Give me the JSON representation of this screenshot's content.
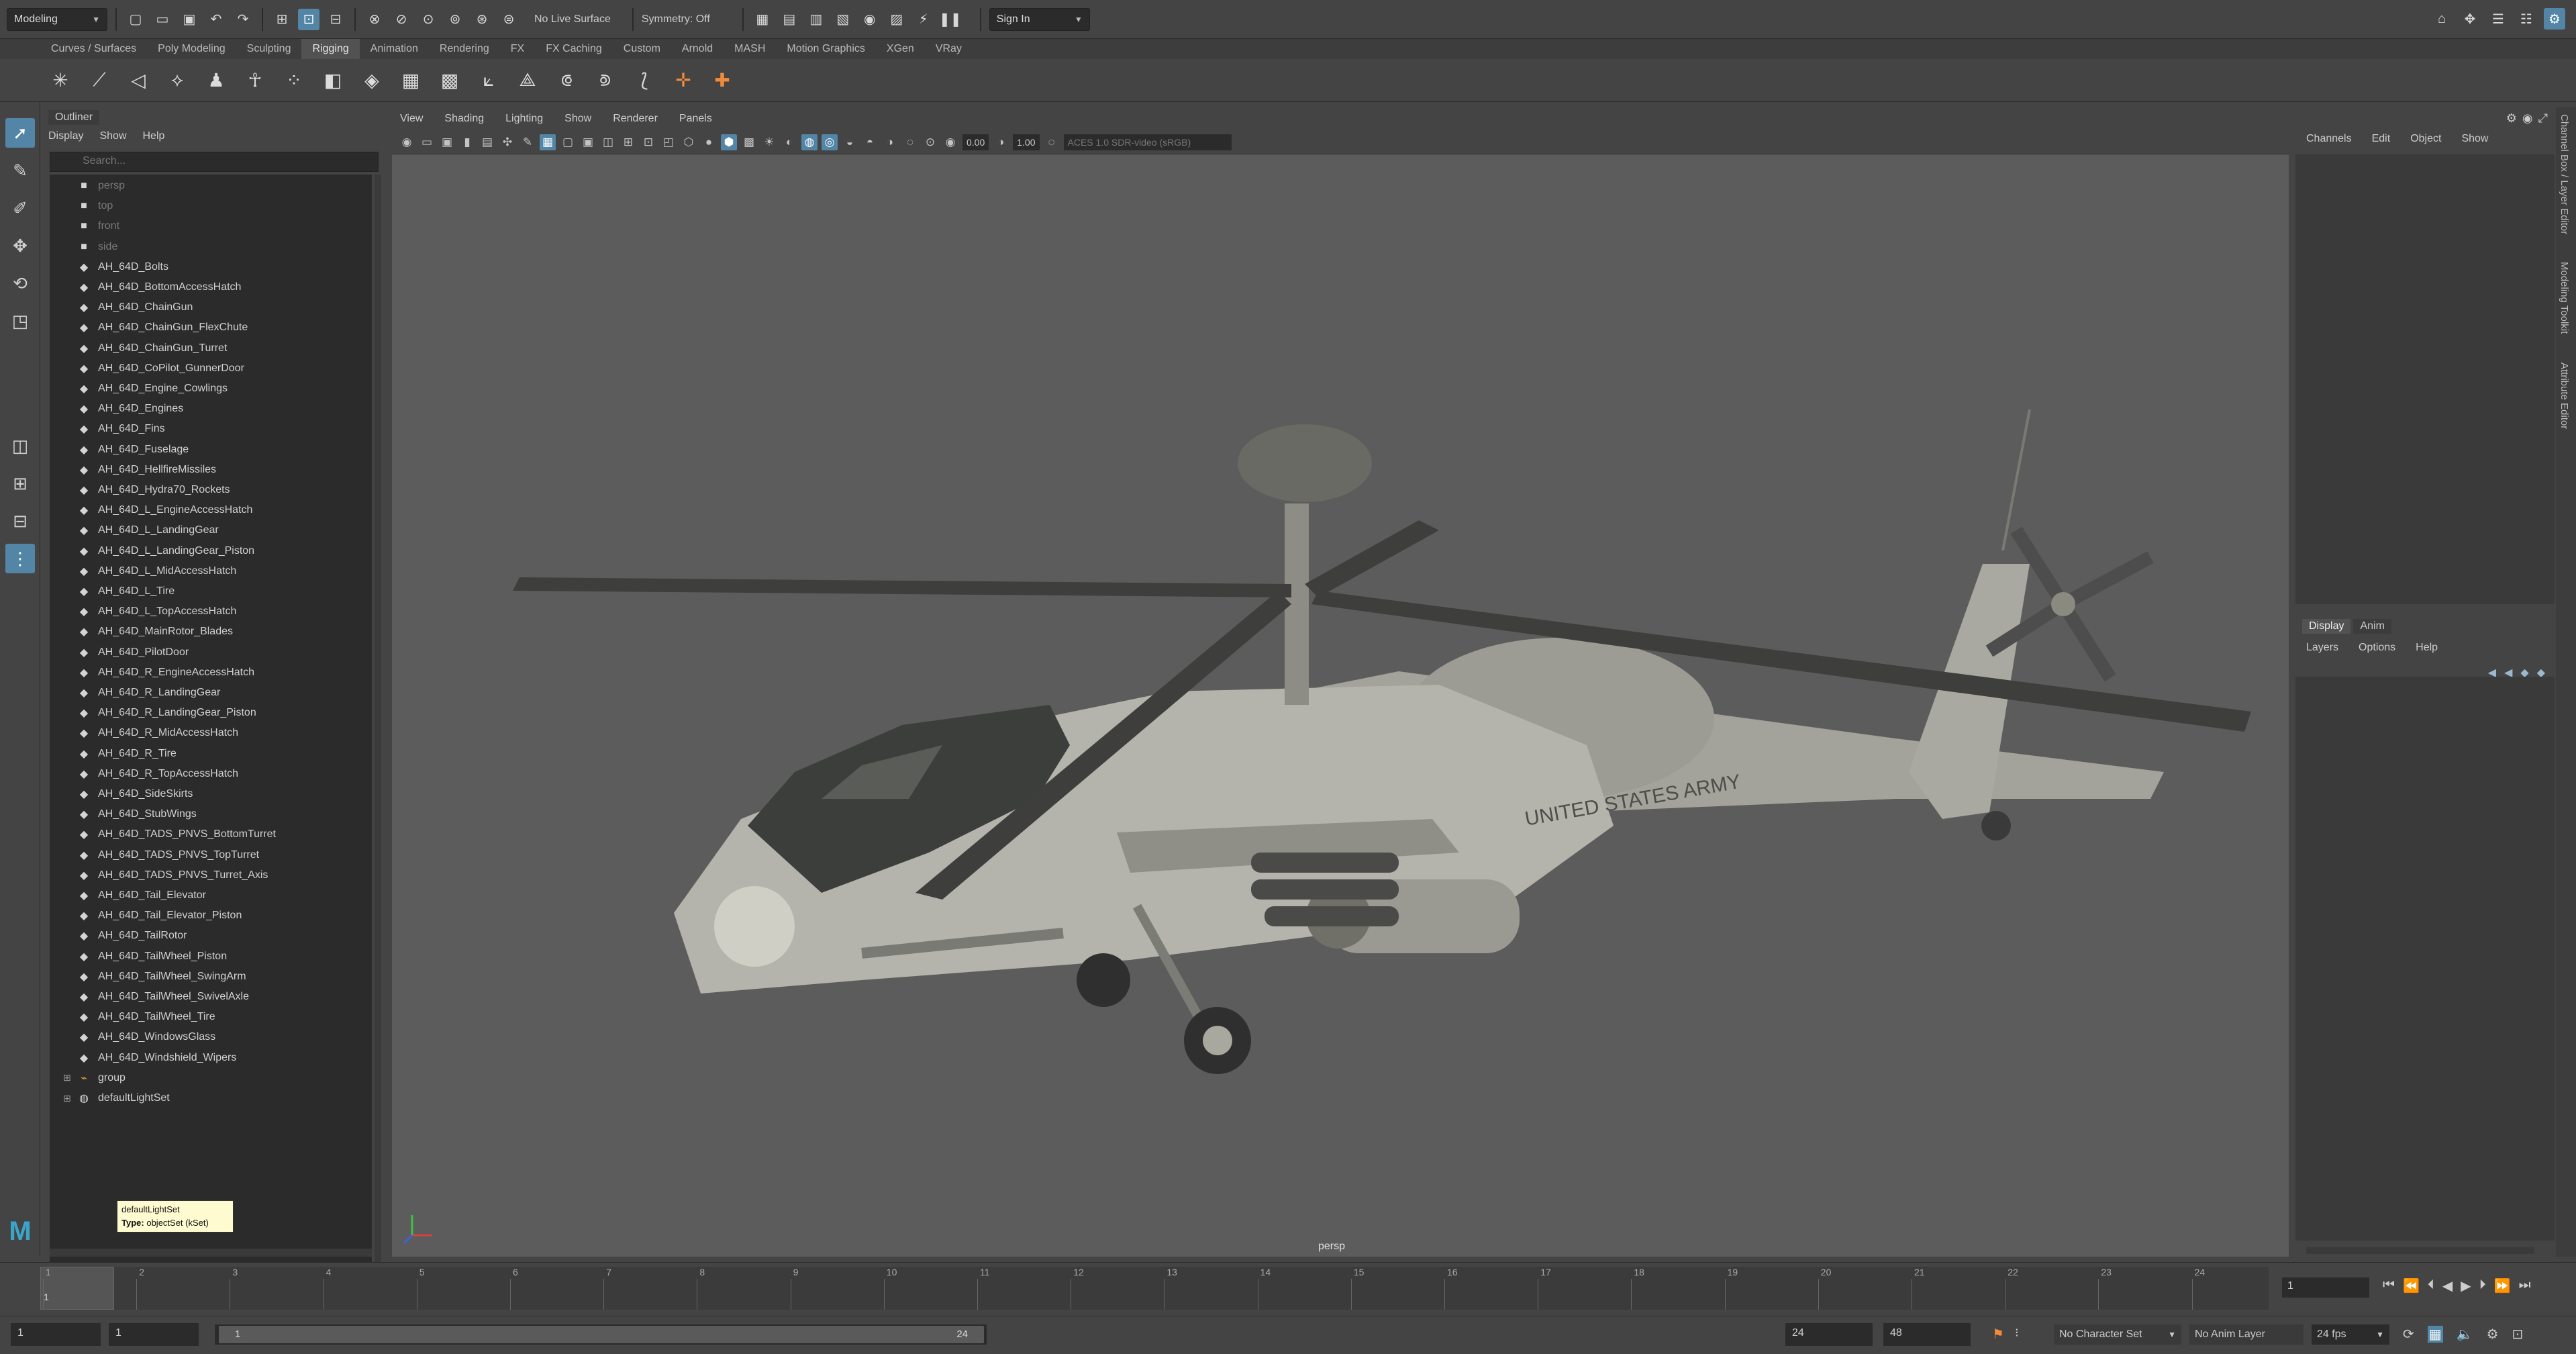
{
  "statusline": {
    "mode": "Modeling",
    "live_surface": "No Live Surface",
    "symmetry": "Symmetry: Off",
    "signin": "Sign In"
  },
  "shelf_tabs": [
    "Curves / Surfaces",
    "Poly Modeling",
    "Sculpting",
    "Rigging",
    "Animation",
    "Rendering",
    "FX",
    "FX Caching",
    "Custom",
    "Arnold",
    "MASH",
    "Motion Graphics",
    "XGen",
    "VRay"
  ],
  "shelf_active": "Rigging",
  "outliner": {
    "title": "Outliner",
    "menu": [
      "Display",
      "Show",
      "Help"
    ],
    "search_placeholder": "Search...",
    "cameras": [
      "persp",
      "top",
      "front",
      "side"
    ],
    "items": [
      "AH_64D_Bolts",
      "AH_64D_BottomAccessHatch",
      "AH_64D_ChainGun",
      "AH_64D_ChainGun_FlexChute",
      "AH_64D_ChainGun_Turret",
      "AH_64D_CoPilot_GunnerDoor",
      "AH_64D_Engine_Cowlings",
      "AH_64D_Engines",
      "AH_64D_Fins",
      "AH_64D_Fuselage",
      "AH_64D_HellfireMissiles",
      "AH_64D_Hydra70_Rockets",
      "AH_64D_L_EngineAccessHatch",
      "AH_64D_L_LandingGear",
      "AH_64D_L_LandingGear_Piston",
      "AH_64D_L_MidAccessHatch",
      "AH_64D_L_Tire",
      "AH_64D_L_TopAccessHatch",
      "AH_64D_MainRotor_Blades",
      "AH_64D_PilotDoor",
      "AH_64D_R_EngineAccessHatch",
      "AH_64D_R_LandingGear",
      "AH_64D_R_LandingGear_Piston",
      "AH_64D_R_MidAccessHatch",
      "AH_64D_R_Tire",
      "AH_64D_R_TopAccessHatch",
      "AH_64D_SideSkirts",
      "AH_64D_StubWings",
      "AH_64D_TADS_PNVS_BottomTurret",
      "AH_64D_TADS_PNVS_TopTurret",
      "AH_64D_TADS_PNVS_Turret_Axis",
      "AH_64D_Tail_Elevator",
      "AH_64D_Tail_Elevator_Piston",
      "AH_64D_TailRotor",
      "AH_64D_TailWheel_Piston",
      "AH_64D_TailWheel_SwingArm",
      "AH_64D_TailWheel_SwivelAxle",
      "AH_64D_TailWheel_Tire",
      "AH_64D_WindowsGlass",
      "AH_64D_Windshield_Wipers"
    ],
    "group": "group",
    "light_set": "defaultLightSet",
    "tooltip_name": "defaultLightSet",
    "tooltip_type_label": "Type:",
    "tooltip_type": "objectSet (kSet)"
  },
  "viewport": {
    "menu": [
      "View",
      "Shading",
      "Lighting",
      "Show",
      "Renderer",
      "Panels"
    ],
    "exposure": "0.00",
    "gamma": "1.00",
    "color_space": "ACES 1.0 SDR-video (sRGB)",
    "camera": "persp",
    "fuselage_text": "UNITED STATES ARMY"
  },
  "channelbox": {
    "menu": [
      "Channels",
      "Edit",
      "Object",
      "Show"
    ]
  },
  "layers": {
    "tabs": [
      "Display",
      "Anim"
    ],
    "menu": [
      "Layers",
      "Options",
      "Help"
    ]
  },
  "side_tabs": [
    "Channel Box / Layer Editor",
    "Modeling Toolkit",
    "Attribute Editor"
  ],
  "timeslider": {
    "ticks": [
      "1",
      "2",
      "3",
      "4",
      "5",
      "6",
      "7",
      "8",
      "9",
      "10",
      "11",
      "12",
      "13",
      "14",
      "15",
      "16",
      "17",
      "18",
      "19",
      "20",
      "21",
      "22",
      "23",
      "24"
    ],
    "current": "1",
    "current_field": "1"
  },
  "range": {
    "start": "1",
    "start2": "1",
    "bar_start": "1",
    "bar_end": "24",
    "end": "24",
    "end2": "48",
    "character_set": "No Character Set",
    "anim_layer": "No Anim Layer",
    "fps": "24 fps"
  },
  "colors": {
    "accent": "#5285a6",
    "viewport_bg": "#5c5c5c",
    "orange": "#f08a3c"
  }
}
